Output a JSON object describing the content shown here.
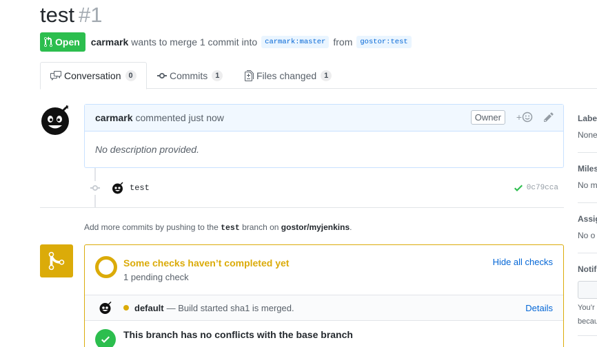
{
  "pr": {
    "title": "test",
    "number": "#1",
    "state": "Open",
    "author": "carmark",
    "summary": "wants to merge 1 commit into",
    "base_branch": "carmark:master",
    "from_word": "from",
    "head_branch": "gostor:test"
  },
  "tabs": [
    {
      "label": "Conversation",
      "count": "0"
    },
    {
      "label": "Commits",
      "count": "1"
    },
    {
      "label": "Files changed",
      "count": "1"
    }
  ],
  "comment": {
    "author": "carmark",
    "action": "commented just now",
    "owner_label": "Owner",
    "reaction": "+",
    "body": "No description provided."
  },
  "commit": {
    "message": "test",
    "sha": "0c79cca",
    "status_color": "#2cbe4e"
  },
  "push_note": {
    "prefix": "Add more commits by pushing to the",
    "branch": "test",
    "middle": "branch on",
    "repo": "gostor/myjenkins",
    "suffix": "."
  },
  "checks": {
    "title": "Some checks haven’t completed yet",
    "subtitle": "1 pending check",
    "toggle": "Hide all checks",
    "pending_color": "#dbab09",
    "items": [
      {
        "name": "default",
        "description": "— Build started sha1 is merged.",
        "link": "Details"
      }
    ]
  },
  "conflicts": {
    "title": "This branch has no conflicts with the base branch"
  },
  "sidebar": {
    "labels": {
      "heading": "Labe",
      "value": "None"
    },
    "milestone": {
      "heading": "Miles",
      "value": "No m"
    },
    "assignees": {
      "heading": "Assig",
      "value": "No o"
    },
    "notifications": {
      "heading": "Notif",
      "note_line1": "You’r",
      "note_line2": "becau"
    }
  },
  "colors": {
    "open_green": "#2cbe4e",
    "link_blue": "#0366d6",
    "pending_yellow": "#dbab09"
  }
}
